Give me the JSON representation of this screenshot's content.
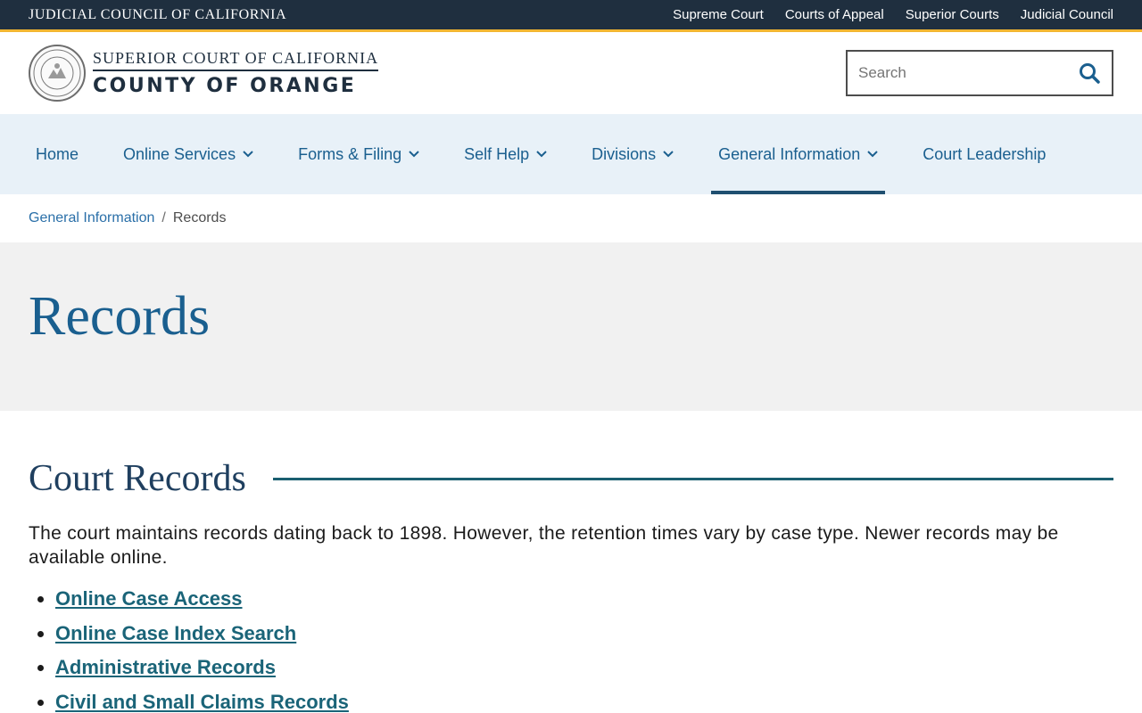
{
  "topbar": {
    "brand": "JUDICIAL COUNCIL OF CALIFORNIA",
    "links": [
      "Supreme Court",
      "Courts of Appeal",
      "Superior Courts",
      "Judicial Council"
    ]
  },
  "header": {
    "logo_line1": "SUPERIOR COURT OF CALIFORNIA",
    "logo_line2": "COUNTY OF ORANGE",
    "search_placeholder": "Search"
  },
  "nav": {
    "items": [
      {
        "label": "Home"
      },
      {
        "label": "Online Services"
      },
      {
        "label": "Forms & Filing"
      },
      {
        "label": "Self Help"
      },
      {
        "label": "Divisions"
      },
      {
        "label": "General Information"
      },
      {
        "label": "Court Leadership"
      }
    ],
    "active": "General Information"
  },
  "breadcrumb": {
    "parent": "General Information",
    "separator": "/",
    "current": "Records"
  },
  "hero": {
    "title": "Records"
  },
  "section": {
    "heading": "Court Records",
    "intro": "The court maintains records dating back to 1898. However, the retention times vary by case type. Newer records may be available online.",
    "links": [
      "Online Case Access",
      "Online Case Index Search",
      "Administrative Records",
      "Civil and Small Claims Records"
    ]
  },
  "colors": {
    "topbar": "#1f2f3f",
    "accent_gold": "#f2b632",
    "nav_bg": "#e8f1f8",
    "link_blue": "#1a5f8f",
    "link_teal": "#1a6478"
  }
}
